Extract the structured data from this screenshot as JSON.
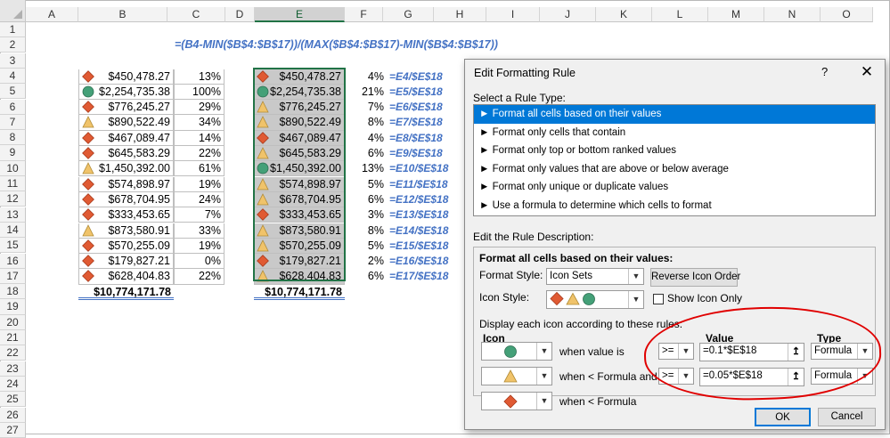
{
  "columns": [
    "A",
    "B",
    "C",
    "D",
    "E",
    "F",
    "G",
    "H",
    "I",
    "J",
    "K",
    "L",
    "M",
    "N",
    "O"
  ],
  "rows": [
    "1",
    "2",
    "3",
    "4",
    "5",
    "6",
    "7",
    "8",
    "9",
    "10",
    "11",
    "12",
    "13",
    "14",
    "15",
    "16",
    "17",
    "18",
    "19",
    "20",
    "21",
    "22",
    "23",
    "24",
    "25",
    "26",
    "27"
  ],
  "formula_note": "=(B4-MIN($B$4:$B$17))/(MAX($B$4:$B$17)-MIN($B$4:$B$17))",
  "table1": [
    {
      "icon": "red-diamond",
      "value": "$450,478.27",
      "pct": "13%"
    },
    {
      "icon": "green-circle",
      "value": "$2,254,735.38",
      "pct": "100%"
    },
    {
      "icon": "red-diamond",
      "value": "$776,245.27",
      "pct": "29%"
    },
    {
      "icon": "yellow-triangle",
      "value": "$890,522.49",
      "pct": "34%"
    },
    {
      "icon": "red-diamond",
      "value": "$467,089.47",
      "pct": "14%"
    },
    {
      "icon": "red-diamond",
      "value": "$645,583.29",
      "pct": "22%"
    },
    {
      "icon": "yellow-triangle",
      "value": "$1,450,392.00",
      "pct": "61%"
    },
    {
      "icon": "red-diamond",
      "value": "$574,898.97",
      "pct": "19%"
    },
    {
      "icon": "red-diamond",
      "value": "$678,704.95",
      "pct": "24%"
    },
    {
      "icon": "red-diamond",
      "value": "$333,453.65",
      "pct": "7%"
    },
    {
      "icon": "yellow-triangle",
      "value": "$873,580.91",
      "pct": "33%"
    },
    {
      "icon": "red-diamond",
      "value": "$570,255.09",
      "pct": "19%"
    },
    {
      "icon": "red-diamond",
      "value": "$179,827.21",
      "pct": "0%"
    },
    {
      "icon": "red-diamond",
      "value": "$628,404.83",
      "pct": "22%"
    }
  ],
  "table1_total": "$10,774,171.78",
  "table2": [
    {
      "icon": "red-diamond",
      "value": "$450,478.27",
      "pct": "4%",
      "formula": "=E4/$E$18"
    },
    {
      "icon": "green-circle",
      "value": "$2,254,735.38",
      "pct": "21%",
      "formula": "=E5/$E$18"
    },
    {
      "icon": "yellow-triangle",
      "value": "$776,245.27",
      "pct": "7%",
      "formula": "=E6/$E$18"
    },
    {
      "icon": "yellow-triangle",
      "value": "$890,522.49",
      "pct": "8%",
      "formula": "=E7/$E$18"
    },
    {
      "icon": "red-diamond",
      "value": "$467,089.47",
      "pct": "4%",
      "formula": "=E8/$E$18"
    },
    {
      "icon": "yellow-triangle",
      "value": "$645,583.29",
      "pct": "6%",
      "formula": "=E9/$E$18"
    },
    {
      "icon": "green-circle",
      "value": "$1,450,392.00",
      "pct": "13%",
      "formula": "=E10/$E$18"
    },
    {
      "icon": "yellow-triangle",
      "value": "$574,898.97",
      "pct": "5%",
      "formula": "=E11/$E$18"
    },
    {
      "icon": "yellow-triangle",
      "value": "$678,704.95",
      "pct": "6%",
      "formula": "=E12/$E$18"
    },
    {
      "icon": "red-diamond",
      "value": "$333,453.65",
      "pct": "3%",
      "formula": "=E13/$E$18"
    },
    {
      "icon": "yellow-triangle",
      "value": "$873,580.91",
      "pct": "8%",
      "formula": "=E14/$E$18"
    },
    {
      "icon": "yellow-triangle",
      "value": "$570,255.09",
      "pct": "5%",
      "formula": "=E15/$E$18"
    },
    {
      "icon": "red-diamond",
      "value": "$179,827.21",
      "pct": "2%",
      "formula": "=E16/$E$18"
    },
    {
      "icon": "yellow-triangle",
      "value": "$628,404.83",
      "pct": "6%",
      "formula": "=E17/$E$18"
    }
  ],
  "table2_total": "$10,774,171.78",
  "dialog": {
    "title": "Edit Formatting Rule",
    "help": "?",
    "close": "✕",
    "select_rule_type": "Select a Rule Type:",
    "rule_types": [
      "► Format all cells based on their values",
      "► Format only cells that contain",
      "► Format only top or bottom ranked values",
      "► Format only values that are above or below average",
      "► Format only unique or duplicate values",
      "► Use a formula to determine which cells to format"
    ],
    "edit_desc": "Edit the Rule Description:",
    "format_all": "Format all cells based on their values:",
    "format_style_label": "Format Style:",
    "format_style_value": "Icon Sets",
    "reverse_btn": "Reverse Icon Order",
    "icon_style_label": "Icon Style:",
    "show_icon_only": "Show Icon Only",
    "display_each": "Display each icon according to these rules:",
    "col_icon": "Icon",
    "col_value": "Value",
    "col_type": "Type",
    "rules": [
      {
        "icon": "green-circle",
        "text": "when value is",
        "op": ">=",
        "value": "=0.1*$E$18",
        "type": "Formula"
      },
      {
        "icon": "yellow-triangle",
        "text": "when < Formula and",
        "op": ">=",
        "value": "=0.05*$E$18",
        "type": "Formula"
      },
      {
        "icon": "red-diamond",
        "text": "when < Formula"
      }
    ],
    "ok": "OK",
    "cancel": "Cancel"
  },
  "colors": {
    "accent": "#217346",
    "formula_blue": "#4472c4",
    "select_blue": "#0078d7",
    "annotation_red": "#e00000",
    "green_icon": "#44a078",
    "yellow_icon": "#f0c36a",
    "red_icon": "#e05a33"
  }
}
